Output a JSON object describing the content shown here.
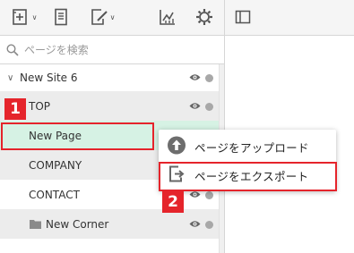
{
  "toolbar": {
    "icons": [
      "add-page-icon",
      "page-icon",
      "edit-page-icon",
      "analytics-icon",
      "settings-icon"
    ],
    "panel_icon": "panel-toggle-icon"
  },
  "search": {
    "placeholder": "ページを検索"
  },
  "tree": {
    "site_name": "New Site 6",
    "items": [
      {
        "label": "TOP"
      },
      {
        "label": "New Page"
      },
      {
        "label": "COMPANY"
      },
      {
        "label": "CONTACT"
      },
      {
        "label": "New Corner"
      }
    ]
  },
  "context_menu": {
    "upload_label": "ページをアップロード",
    "export_label": "ページをエクスポート"
  },
  "annotations": {
    "step1": "1",
    "step2": "2"
  },
  "colors": {
    "highlight_red": "#e5242b",
    "selected_row": "#d6f2e4",
    "icon_gray": "#777777"
  }
}
